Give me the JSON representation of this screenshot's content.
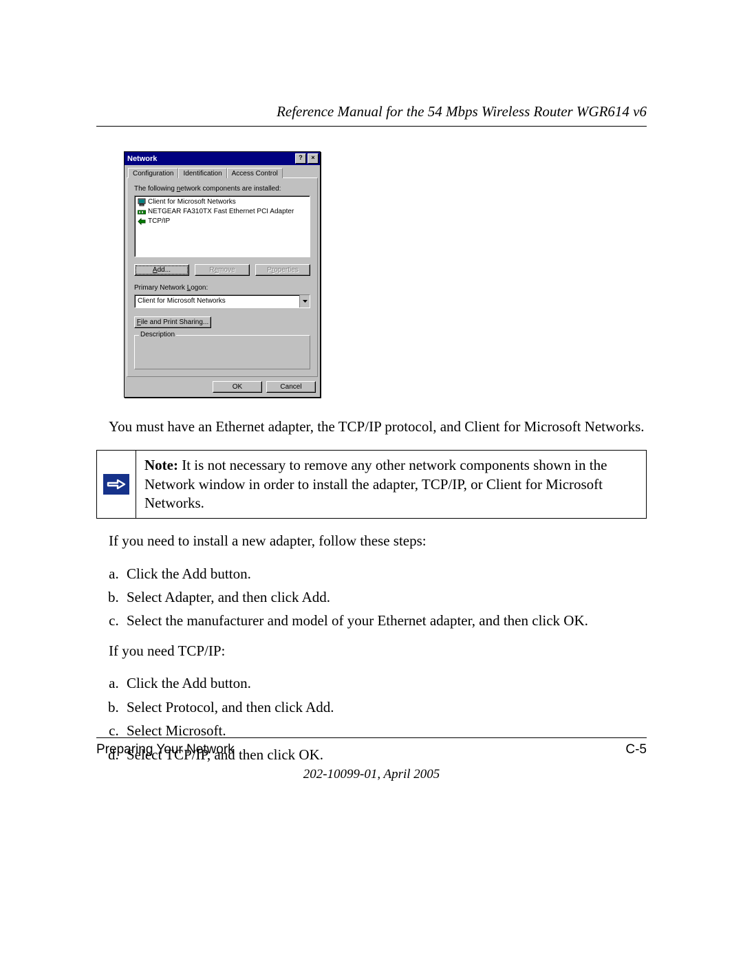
{
  "header": {
    "running_title": "Reference Manual for the 54 Mbps Wireless Router WGR614 v6"
  },
  "dialog": {
    "title": "Network",
    "help_caption": "?",
    "close_caption": "×",
    "tabs": {
      "configuration": "Configuration",
      "identification": "Identification",
      "access_control": "Access Control"
    },
    "components_label": "The following network components are installed:",
    "components": [
      "Client for Microsoft Networks",
      "NETGEAR FA310TX Fast Ethernet PCI Adapter",
      "TCP/IP"
    ],
    "buttons": {
      "add": "Add...",
      "remove": "Remove",
      "properties": "Properties"
    },
    "primary_logon_label": "Primary Network Logon:",
    "primary_logon_value": "Client for Microsoft Networks",
    "file_print_sharing": "File and Print Sharing...",
    "description_legend": "Description",
    "ok": "OK",
    "cancel": "Cancel"
  },
  "body": {
    "requirement": "You must have an Ethernet adapter, the TCP/IP protocol, and Client for Microsoft Networks.",
    "note_label": "Note:",
    "note_text": " It is not necessary to remove any other network components shown in the Network window in order to install the adapter, TCP/IP, or Client for Microsoft Networks.",
    "adapter_intro": "If you need to install a new adapter, follow these steps:",
    "adapter_steps": [
      "Click the Add button.",
      "Select Adapter, and then click Add.",
      "Select the manufacturer and model of your Ethernet adapter, and then click OK."
    ],
    "tcpip_intro": "If you need TCP/IP:",
    "tcpip_steps": [
      "Click the Add button.",
      "Select Protocol, and then click Add.",
      "Select Microsoft.",
      "Select TCP/IP, and then click OK."
    ]
  },
  "footer": {
    "section": "Preparing Your Network",
    "page_number": "C-5",
    "doc_version": "202-10099-01, April 2005"
  }
}
